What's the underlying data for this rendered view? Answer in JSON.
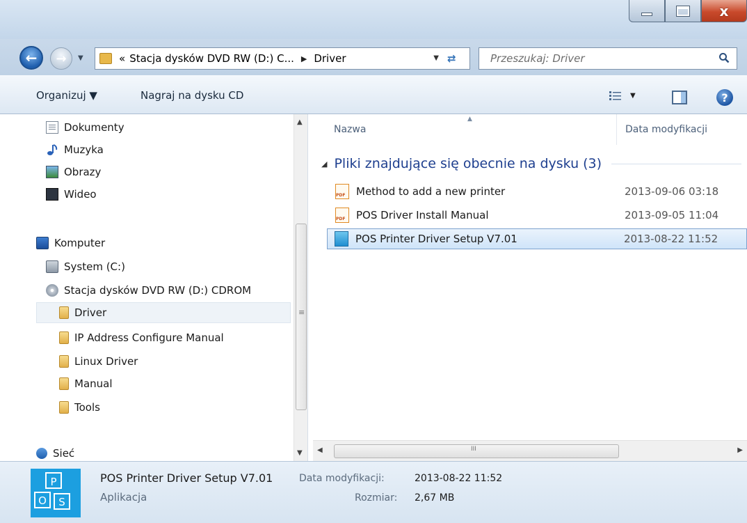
{
  "window": {
    "minimize_icon": "minimize-icon",
    "maximize_icon": "maximize-icon",
    "close_glyph": "x"
  },
  "address_bar": {
    "prefix": "«",
    "path_segment": "Stacja dysków DVD RW (D:) C...",
    "separator": "▶",
    "current": "Driver",
    "dropdown": "▼"
  },
  "search": {
    "placeholder": "Przeszukaj: Driver"
  },
  "toolbar": {
    "organize_label": "Organizuj ▼",
    "burn_label": "Nagraj na dysku CD",
    "view_dropdown": "▼",
    "help_glyph": "?"
  },
  "navigation": {
    "library_items": [
      {
        "label": "Dokumenty",
        "icon": "document-icon"
      },
      {
        "label": "Muzyka",
        "icon": "music-icon"
      },
      {
        "label": "Obrazy",
        "icon": "pictures-icon"
      },
      {
        "label": "Wideo",
        "icon": "video-icon"
      }
    ],
    "computer": {
      "label": "Komputer",
      "icon": "computer-icon"
    },
    "drives": [
      {
        "label": "System (C:)",
        "icon": "drive-icon"
      },
      {
        "label": "Stacja dysków DVD RW (D:) CDROM",
        "icon": "dvd-icon"
      }
    ],
    "folders": [
      {
        "label": "Driver",
        "selected": true
      },
      {
        "label": "IP Address Configure Manual",
        "selected": false
      },
      {
        "label": "Linux Driver",
        "selected": false
      },
      {
        "label": "Manual",
        "selected": false
      },
      {
        "label": "Tools",
        "selected": false
      }
    ],
    "network": {
      "label": "Sieć",
      "icon": "network-icon"
    }
  },
  "file_list": {
    "columns": {
      "name": "Nazwa",
      "date": "Data modyfikacji"
    },
    "group_label": "Pliki znajdujące się obecnie na dysku (3)",
    "files": [
      {
        "name": "Method to add a new printer",
        "date": "2013-09-06 03:18",
        "icon": "pdf-icon",
        "selected": false
      },
      {
        "name": "POS Driver Install Manual",
        "date": "2013-09-05 11:04",
        "icon": "pdf-icon",
        "selected": false
      },
      {
        "name": "POS Printer Driver Setup V7.01",
        "date": "2013-08-22 11:52",
        "icon": "application-icon",
        "selected": true
      }
    ]
  },
  "details": {
    "name": "POS Printer Driver Setup V7.01",
    "type": "Aplikacja",
    "modified_label": "Data modyfikacji:",
    "modified_value": "2013-08-22 11:52",
    "size_label": "Rozmiar:",
    "size_value": "2,67 MB"
  },
  "colors": {
    "accent": "#1e3f8f",
    "selection": "#cfe4f9",
    "close_button": "#c94a2c"
  }
}
